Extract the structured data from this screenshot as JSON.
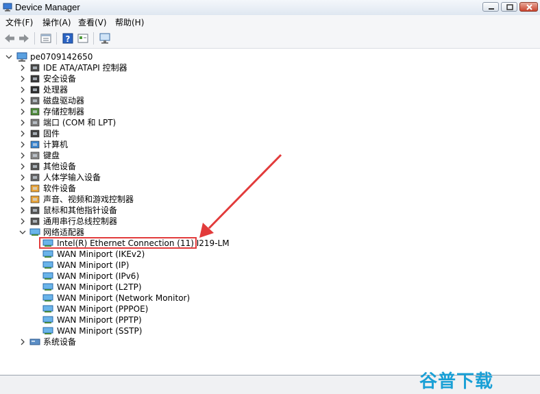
{
  "window": {
    "title": "Device Manager"
  },
  "menu": [
    "文件(F)",
    "操作(A)",
    "查看(V)",
    "帮助(H)"
  ],
  "tree": {
    "root": "pe0709142650",
    "categories": [
      {
        "label": "IDE ATA/ATAPI 控制器",
        "icon": "ide-controller-icon"
      },
      {
        "label": "安全设备",
        "icon": "security-device-icon"
      },
      {
        "label": "处理器",
        "icon": "processor-icon"
      },
      {
        "label": "磁盘驱动器",
        "icon": "disk-drive-icon"
      },
      {
        "label": "存储控制器",
        "icon": "storage-controller-icon"
      },
      {
        "label": "端口 (COM 和 LPT)",
        "icon": "port-icon"
      },
      {
        "label": "固件",
        "icon": "firmware-icon"
      },
      {
        "label": "计算机",
        "icon": "computer-icon"
      },
      {
        "label": "键盘",
        "icon": "keyboard-icon"
      },
      {
        "label": "其他设备",
        "icon": "other-device-icon"
      },
      {
        "label": "人体学输入设备",
        "icon": "hid-icon"
      },
      {
        "label": "软件设备",
        "icon": "software-device-icon"
      },
      {
        "label": "声音、视频和游戏控制器",
        "icon": "sound-icon"
      },
      {
        "label": "鼠标和其他指针设备",
        "icon": "mouse-icon"
      },
      {
        "label": "通用串行总线控制器",
        "icon": "usb-icon"
      }
    ],
    "network": {
      "label": "网络适配器",
      "children": [
        "Intel(R) Ethernet Connection (11) I219-LM",
        "WAN Miniport (IKEv2)",
        "WAN Miniport (IP)",
        "WAN Miniport (IPv6)",
        "WAN Miniport (L2TP)",
        "WAN Miniport (Network Monitor)",
        "WAN Miniport (PPPOE)",
        "WAN Miniport (PPTP)",
        "WAN Miniport (SSTP)"
      ]
    },
    "system": "系统设备"
  },
  "watermark": "谷普下载",
  "colors": {
    "highlight": "#e23b3b",
    "watermark": "#1aa0d6"
  }
}
